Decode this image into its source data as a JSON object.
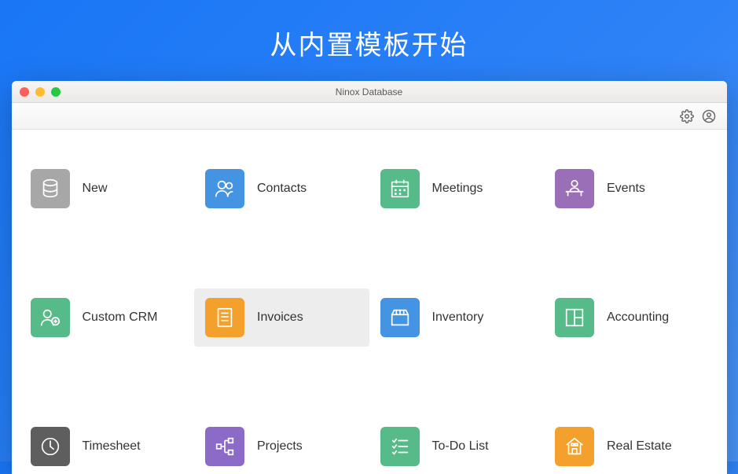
{
  "page": {
    "title": "从内置模板开始"
  },
  "window": {
    "title": "Ninox Database"
  },
  "colors": {
    "grey": "#a7a7a7",
    "blue": "#4593e3",
    "green": "#56ba89",
    "purple": "#9a6fb8",
    "orange": "#f3a02c",
    "dark_grey": "#5e5e5e",
    "purple2": "#8b6bc7"
  },
  "tiles": [
    {
      "id": "new",
      "label": "New",
      "icon": "database-icon",
      "color": "grey",
      "selected": false
    },
    {
      "id": "contacts",
      "label": "Contacts",
      "icon": "people-icon",
      "color": "blue",
      "selected": false
    },
    {
      "id": "meetings",
      "label": "Meetings",
      "icon": "calendar-icon",
      "color": "green",
      "selected": false
    },
    {
      "id": "events",
      "label": "Events",
      "icon": "person-desk-icon",
      "color": "purple",
      "selected": false
    },
    {
      "id": "custom-crm",
      "label": "Custom CRM",
      "icon": "people-plus-icon",
      "color": "green",
      "selected": false
    },
    {
      "id": "invoices",
      "label": "Invoices",
      "icon": "document-icon",
      "color": "orange",
      "selected": true
    },
    {
      "id": "inventory",
      "label": "Inventory",
      "icon": "box-icon",
      "color": "blue",
      "selected": false
    },
    {
      "id": "accounting",
      "label": "Accounting",
      "icon": "layout-icon",
      "color": "green",
      "selected": false
    },
    {
      "id": "timesheet",
      "label": "Timesheet",
      "icon": "clock-icon",
      "color": "dark_grey",
      "selected": false
    },
    {
      "id": "projects",
      "label": "Projects",
      "icon": "sitemap-icon",
      "color": "purple2",
      "selected": false
    },
    {
      "id": "todo-list",
      "label": "To-Do List",
      "icon": "checklist-icon",
      "color": "green",
      "selected": false
    },
    {
      "id": "real-estate",
      "label": "Real Estate",
      "icon": "house-icon",
      "color": "orange",
      "selected": false
    }
  ]
}
